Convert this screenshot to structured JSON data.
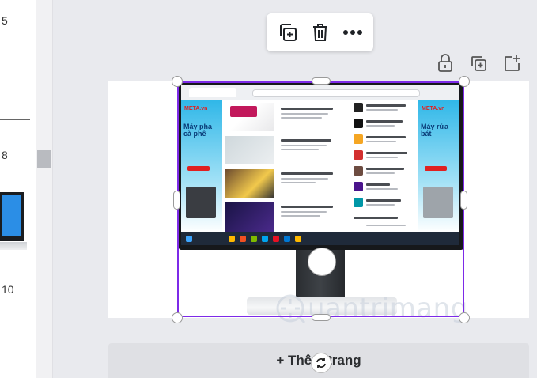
{
  "sidebar": {
    "page_numbers": [
      "5",
      "8",
      "10"
    ]
  },
  "toolbar": {
    "items": [
      {
        "name": "duplicate",
        "icon": "duplicate-icon"
      },
      {
        "name": "delete",
        "icon": "trash-icon"
      },
      {
        "name": "more",
        "icon": "more-dots-icon"
      }
    ]
  },
  "page_actions": {
    "items": [
      {
        "name": "lock",
        "icon": "lock-icon"
      },
      {
        "name": "duplicate-page",
        "icon": "copy-plus-icon"
      },
      {
        "name": "add-page",
        "icon": "add-page-icon"
      }
    ]
  },
  "add_page": {
    "label": "+ Thêm trang"
  },
  "watermark": {
    "text": "uantrimang"
  },
  "ads": {
    "left": {
      "brand": "META.vn",
      "slogan": "Máy pha cà phê"
    },
    "right": {
      "brand": "META.vn",
      "slogan": "Máy rửa bát"
    }
  },
  "colors": {
    "selection": "#7d2ae8",
    "canvas_bg": "#e9eaee",
    "page_bg": "#ffffff"
  }
}
